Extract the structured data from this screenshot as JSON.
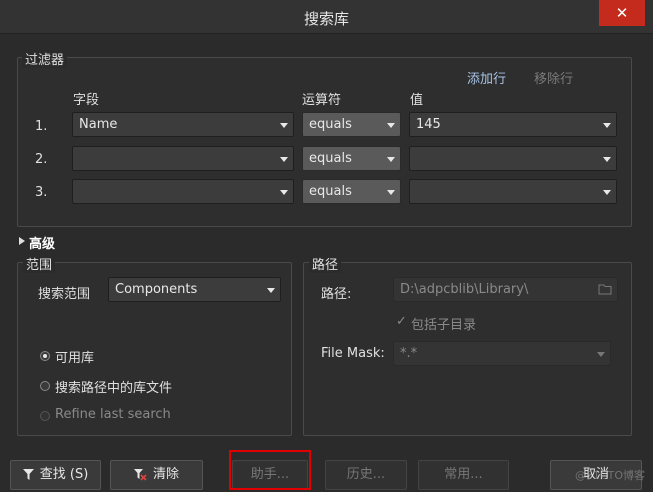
{
  "window": {
    "title": "搜索库",
    "close_glyph": "✕"
  },
  "filter": {
    "group_label": "过滤器",
    "add_row": "添加行",
    "remove_row": "移除行",
    "col_field": "字段",
    "col_operator": "运算符",
    "col_value": "值",
    "rows": [
      {
        "index": "1.",
        "field": "Name",
        "operator": "equals",
        "value": "145"
      },
      {
        "index": "2.",
        "field": "",
        "operator": "equals",
        "value": ""
      },
      {
        "index": "3.",
        "field": "",
        "operator": "equals",
        "value": ""
      }
    ]
  },
  "advanced": {
    "label": "高级"
  },
  "scope": {
    "group_label": "范围",
    "search_scope_label": "搜索范围",
    "search_scope_value": "Components",
    "options": [
      {
        "label": "可用库",
        "checked": true,
        "enabled": true
      },
      {
        "label": "搜索路径中的库文件",
        "checked": false,
        "enabled": true
      },
      {
        "label": "Refine last search",
        "checked": false,
        "enabled": false
      }
    ]
  },
  "path": {
    "group_label": "路径",
    "path_label": "路径:",
    "path_value": "D:\\adpcblib\\Library\\",
    "include_subdirs": "包括子目录",
    "file_mask_label": "File Mask:",
    "file_mask_value": "*.*"
  },
  "buttons": {
    "search": "查找 (S)",
    "clear": "清除",
    "helper": "助手...",
    "history": "历史...",
    "favorites": "常用...",
    "cancel": "取消"
  },
  "watermark": "@51CTO博客",
  "colors": {
    "accent_link": "#a9c4e8",
    "highlight": "#e00000",
    "close": "#c42b1c"
  }
}
